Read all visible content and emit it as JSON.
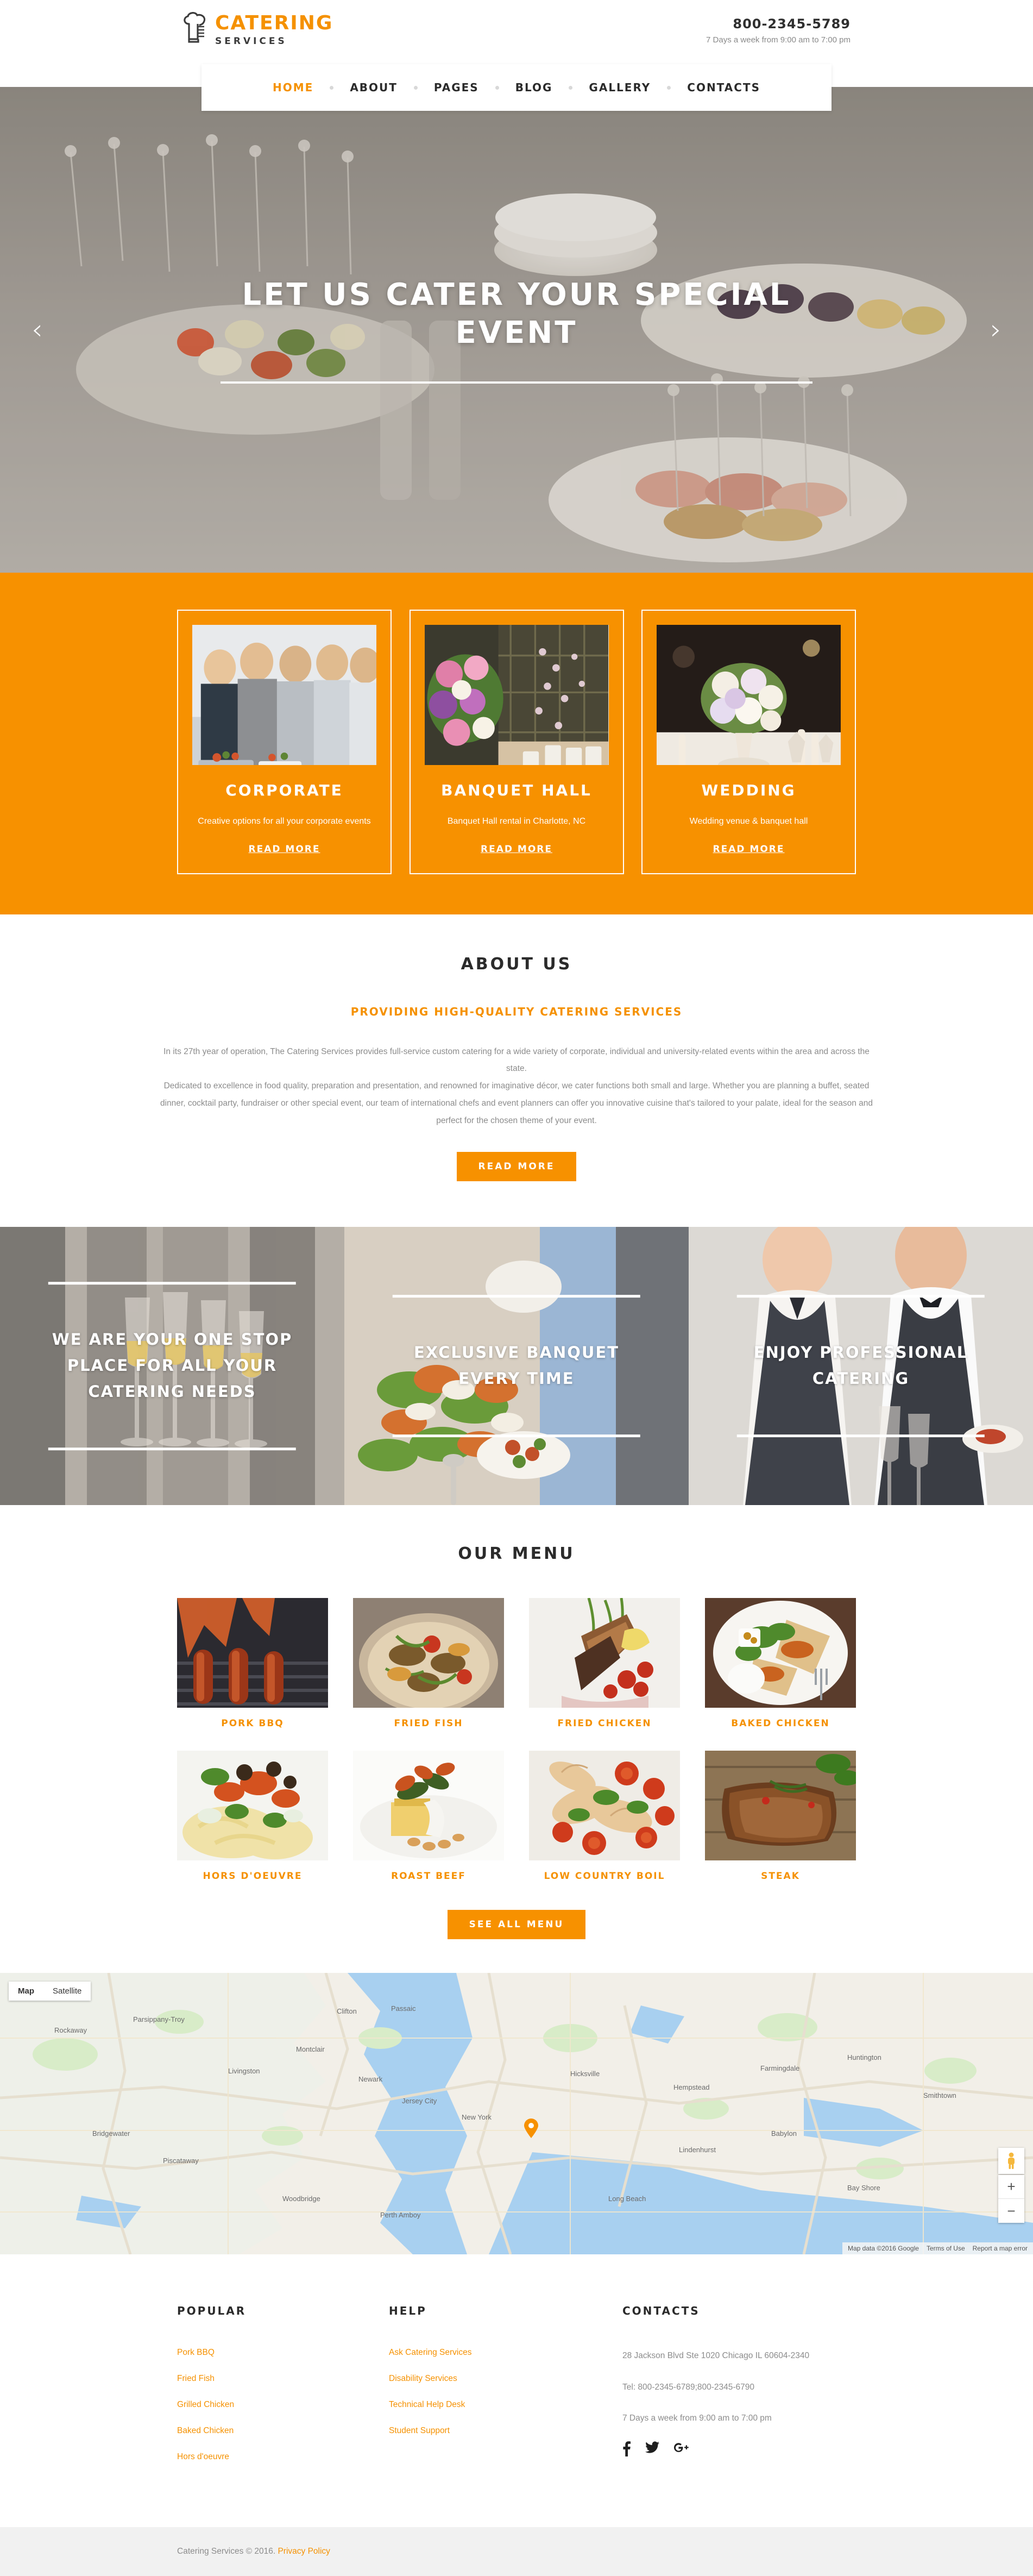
{
  "brand": {
    "name_top": "CATERING",
    "name_bottom": "SERVICES",
    "logo_icon": "chef-hat-icon",
    "accent": "#f79100"
  },
  "header": {
    "phone": "800-2345-5789",
    "hours": "7 Days a week from 9:00 am to 7:00 pm"
  },
  "nav": {
    "items": [
      {
        "label": "HOME",
        "active": true
      },
      {
        "label": "ABOUT",
        "active": false
      },
      {
        "label": "PAGES",
        "active": false
      },
      {
        "label": "BLOG",
        "active": false
      },
      {
        "label": "GALLERY",
        "active": false
      },
      {
        "label": "CONTACTS",
        "active": false
      }
    ]
  },
  "hero": {
    "title": "LET US CATER YOUR SPECIAL EVENT",
    "prev_icon": "chevron-left-icon",
    "next_icon": "chevron-right-icon"
  },
  "services": {
    "cards": [
      {
        "title": "CORPORATE",
        "desc": "Creative options for all your corporate events",
        "link": "READ MORE",
        "image_alt": "corporate-buffet-photo"
      },
      {
        "title": "BANQUET HALL",
        "desc": "Banquet Hall rental in Charlotte, NC",
        "link": "READ MORE",
        "image_alt": "banquet-hall-flowers-photo"
      },
      {
        "title": "WEDDING",
        "desc": "Wedding venue & banquet hall",
        "link": "READ MORE",
        "image_alt": "wedding-bouquet-table-photo"
      }
    ]
  },
  "about": {
    "title": "ABOUT US",
    "subtitle": "PROVIDING HIGH-QUALITY CATERING SERVICES",
    "paragraphs": [
      "In its 27th year of operation, The Catering Services provides full-service custom catering for a wide variety of corporate, individual and university-related events within the area and across the state.",
      "Dedicated to excellence in food quality, preparation and presentation, and renowned for imaginative décor, we cater functions both small and large. Whether you are planning a buffet, seated dinner, cocktail party, fundraiser or other special event, our team of international chefs and event planners can offer you innovative cuisine that's tailored to your palate, ideal for the season and perfect for the chosen theme of your event."
    ],
    "button": "READ MORE"
  },
  "promo": {
    "cells": [
      {
        "text": "WE ARE YOUR ONE STOP PLACE FOR ALL YOUR CATERING NEEDS",
        "image_alt": "champagne-glasses-photo"
      },
      {
        "text": "EXCLUSIVE BANQUET EVERY TIME",
        "image_alt": "buffet-plates-photo"
      },
      {
        "text": "ENJOY PROFESSIONAL CATERING",
        "image_alt": "waiters-smiling-photo"
      }
    ]
  },
  "menu": {
    "title": "OUR MENU",
    "items": [
      {
        "label": "PORK BBQ",
        "image_alt": "grilled-sausages-photo"
      },
      {
        "label": "FRIED FISH",
        "image_alt": "fried-fish-pan-photo"
      },
      {
        "label": "FRIED CHICKEN",
        "image_alt": "fried-chicken-plate-photo"
      },
      {
        "label": "BAKED CHICKEN",
        "image_alt": "baked-chicken-salad-photo"
      },
      {
        "label": "HORS D'OEUVRE",
        "image_alt": "pasta-olives-photo"
      },
      {
        "label": "ROAST BEEF",
        "image_alt": "roast-beef-plate-photo"
      },
      {
        "label": "LOW COUNTRY BOIL",
        "image_alt": "shrimp-tomatoes-photo"
      },
      {
        "label": "STEAK",
        "image_alt": "steak-rosemary-photo"
      }
    ],
    "button": "SEE ALL MENU"
  },
  "map": {
    "type_map": "Map",
    "type_satellite": "Satellite",
    "pegman_icon": "street-view-pegman-icon",
    "zoom_in": "+",
    "zoom_out": "−",
    "marker_icon": "map-pin-icon",
    "attribution": "Map data ©2016 Google",
    "terms": "Terms of Use",
    "report": "Report a map error",
    "city_label": "New York"
  },
  "footer": {
    "popular": {
      "title": "POPULAR",
      "links": [
        "Pork BBQ",
        "Fried Fish",
        "Grilled Chicken",
        "Baked Chicken",
        "Hors d'oeuvre"
      ]
    },
    "help": {
      "title": "HELP",
      "links": [
        "Ask Catering Services",
        "Disability Services",
        "Technical Help Desk",
        "Student Support"
      ]
    },
    "contacts": {
      "title": "CONTACTS",
      "address": "28 Jackson Blvd Ste 1020 Chicago IL 60604-2340",
      "tel": "Tel: 800-2345-6789;800-2345-6790",
      "hours": "7 Days a week from 9:00 am to 7:00 pm",
      "socials": [
        {
          "name": "facebook-icon",
          "glyph": "f"
        },
        {
          "name": "twitter-icon",
          "glyph": "🐦"
        },
        {
          "name": "google-plus-icon",
          "glyph": "g+"
        }
      ]
    }
  },
  "copyright": {
    "text": "Catering Services © 2016.",
    "privacy": "Privacy Policy"
  }
}
